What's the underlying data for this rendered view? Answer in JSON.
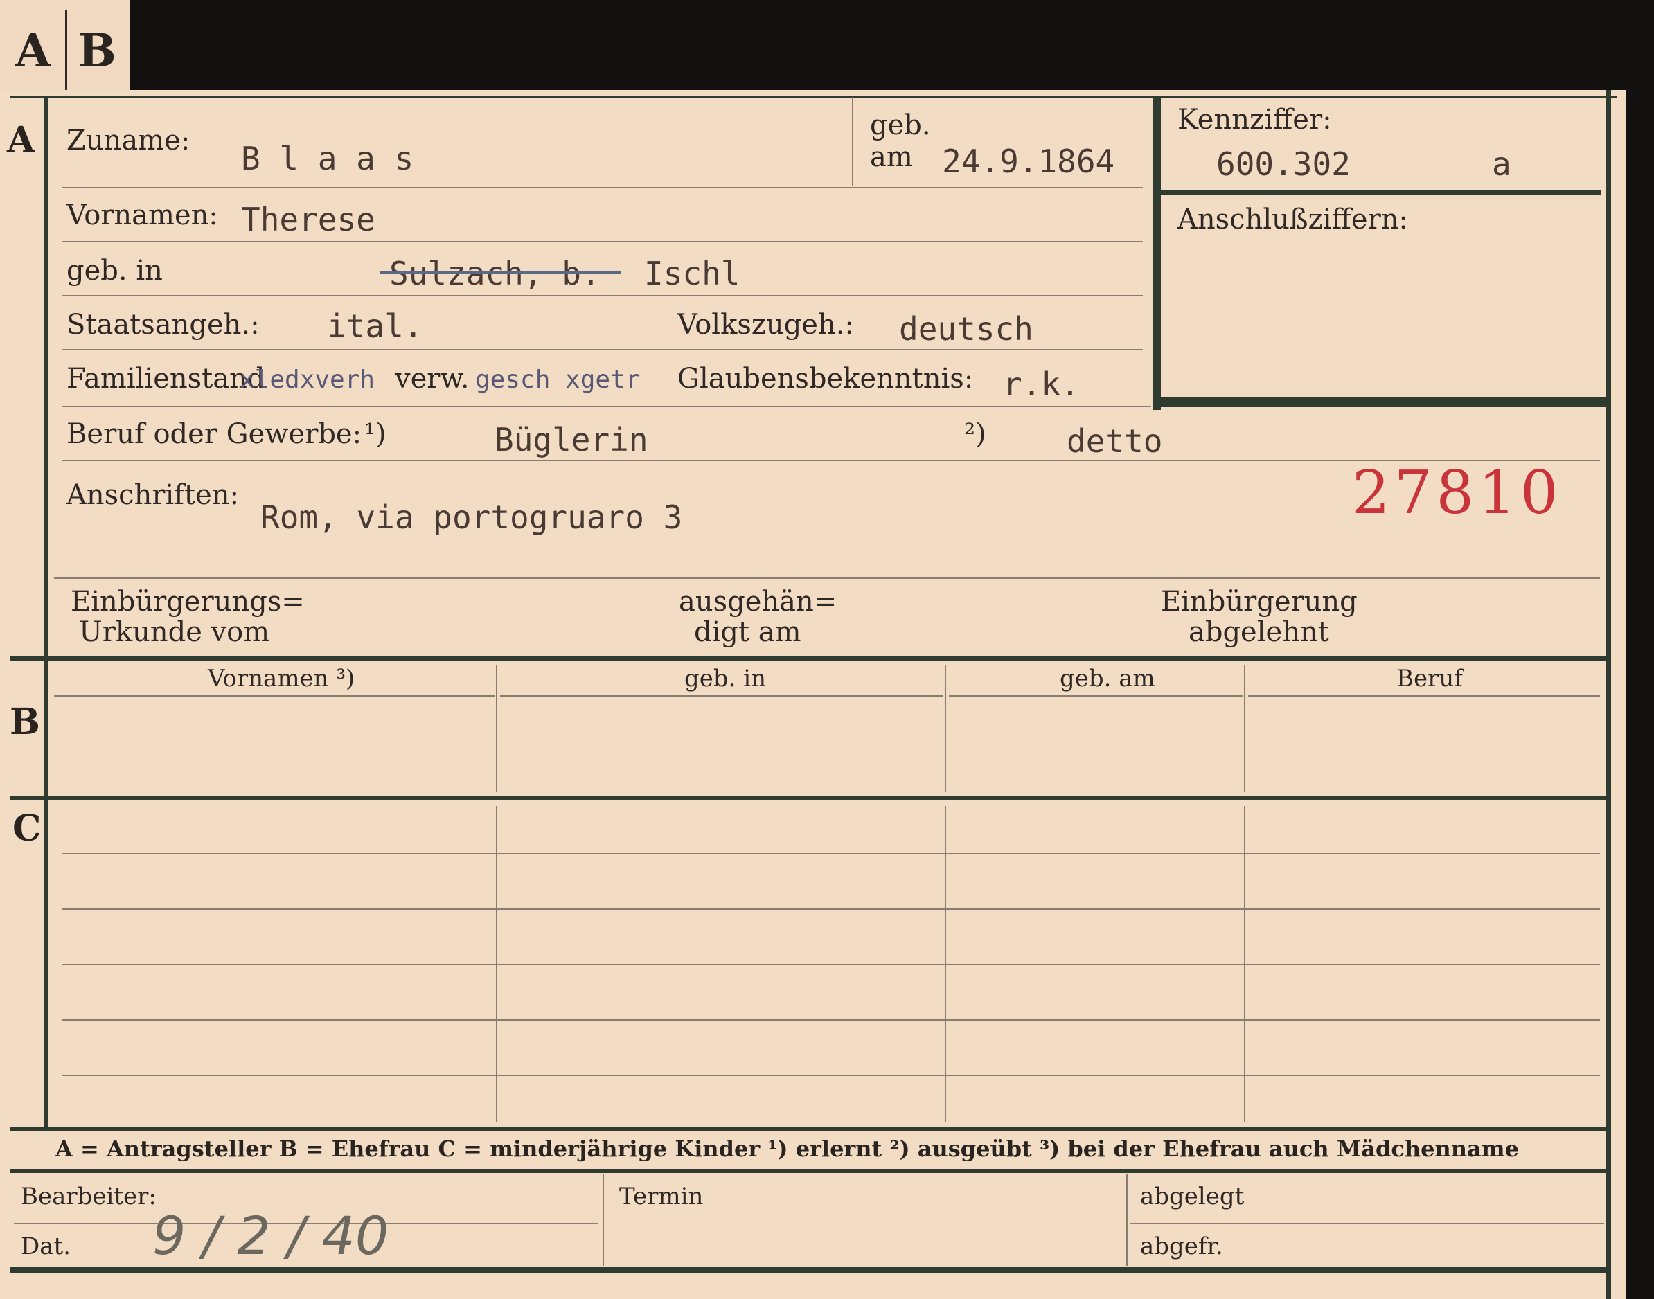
{
  "tab": {
    "a": "A",
    "b": "B"
  },
  "section_labels": {
    "a": "A",
    "b": "B",
    "c": "C"
  },
  "person": {
    "surname_label": "Zuname:",
    "surname": "B l a a s",
    "born_label_1": "geb.",
    "born_label_2": "am",
    "birth_date": "24.9.1864",
    "id_label": "Kennziffer:",
    "id_value": "600.302",
    "id_suffix": "a",
    "first_names_label": "Vornamen:",
    "first_names": "Therese",
    "connections_label": "Anschlußziffern:",
    "birthplace_label": "geb. in",
    "birthplace_struck": "Sulzach, b.",
    "birthplace": "Ischl",
    "citizenship_label": "Staatsangeh.:",
    "citizenship": "ital.",
    "ethnicity_label": "Volkszugeh.:",
    "ethnicity": "deutsch",
    "marital_label": "Familienstand",
    "marital_struck_1": "xledxverh",
    "marital_value": "verw.",
    "marital_struck_2": "gesch xgetr",
    "religion_label": "Glaubensbekenntnis:",
    "religion": "r.k.",
    "occupation_label": "Beruf oder Gewerbe:",
    "occupation_mark_1": "¹)",
    "occupation_learned": "Büglerin",
    "occupation_mark_2": "²)",
    "occupation_practiced": "detto",
    "address_label": "Anschriften:",
    "address": "Rom, via portogruaro 3",
    "stamp_number": "27810",
    "naturalization_label_1": "Einbürgerungs=",
    "naturalization_label_2": "Urkunde vom",
    "handed_label_1": "ausgehän=",
    "handed_label_2": "digt am",
    "rejected_label_1": "Einbürgerung",
    "rejected_label_2": "abgelehnt"
  },
  "table": {
    "headers": [
      "Vornamen ³)",
      "geb. in",
      "geb. am",
      "Beruf"
    ]
  },
  "legend": {
    "text": "A = Antragsteller   B = Ehefrau   C = minderjährige Kinder   ¹) erlernt   ²) ausgeübt   ³) bei der Ehefrau auch Mädchenname"
  },
  "footer": {
    "clerk_label": "Bearbeiter:",
    "date_label": "Dat.",
    "date_handwritten": "9 / 2 / 40",
    "deadline_label": "Termin",
    "filed_label": "abgelegt",
    "done_label": "abgefr."
  }
}
